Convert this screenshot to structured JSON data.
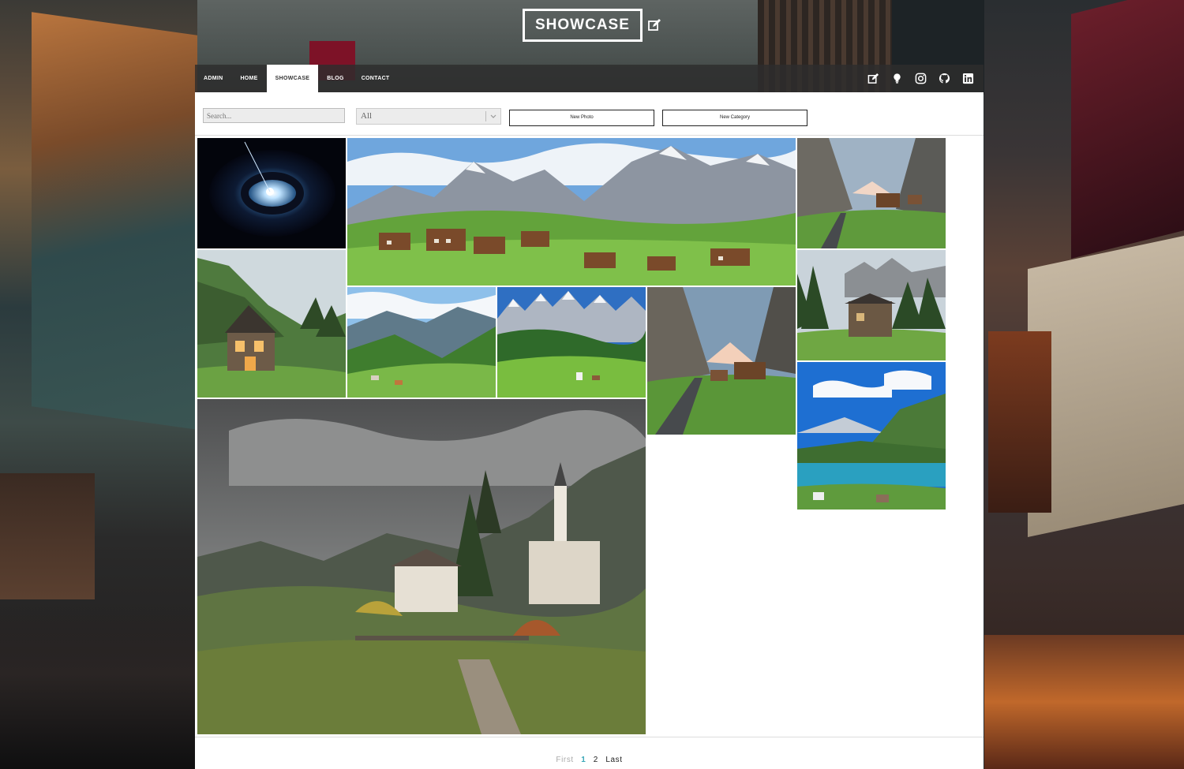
{
  "brand": {
    "title": "SHOWCASE"
  },
  "nav": {
    "items": [
      {
        "label": "ADMIN"
      },
      {
        "label": "HOME"
      },
      {
        "label": "SHOWCASE"
      },
      {
        "label": "BLOG"
      },
      {
        "label": "CONTACT"
      }
    ],
    "active_index": 2,
    "icons": [
      "edit-icon",
      "lightbulb-icon",
      "instagram-icon",
      "github-icon",
      "linkedin-icon"
    ]
  },
  "toolbar": {
    "search_placeholder": "Search...",
    "category_value": "All",
    "new_photo_label": "New Photo",
    "new_category_label": "New Category"
  },
  "gallery": {
    "photos": [
      {
        "subject": "galaxy"
      },
      {
        "subject": "alpine village wide"
      },
      {
        "subject": "valley road chalets"
      },
      {
        "subject": "wooden cabin mountain"
      },
      {
        "subject": "green valley"
      },
      {
        "subject": "dolomites meadow"
      },
      {
        "subject": "valley road chalets tall"
      },
      {
        "subject": "cabin in forest"
      },
      {
        "subject": "alpine lake"
      },
      {
        "subject": "mountain village church"
      }
    ]
  },
  "pagination": {
    "first_label": "First",
    "pages": [
      "1",
      "2"
    ],
    "current": "1",
    "last_label": "Last"
  },
  "colors": {
    "accent": "#3aa7b8",
    "nav_bg": "#2d2d2d",
    "active_tab_bg": "#ffffff"
  }
}
